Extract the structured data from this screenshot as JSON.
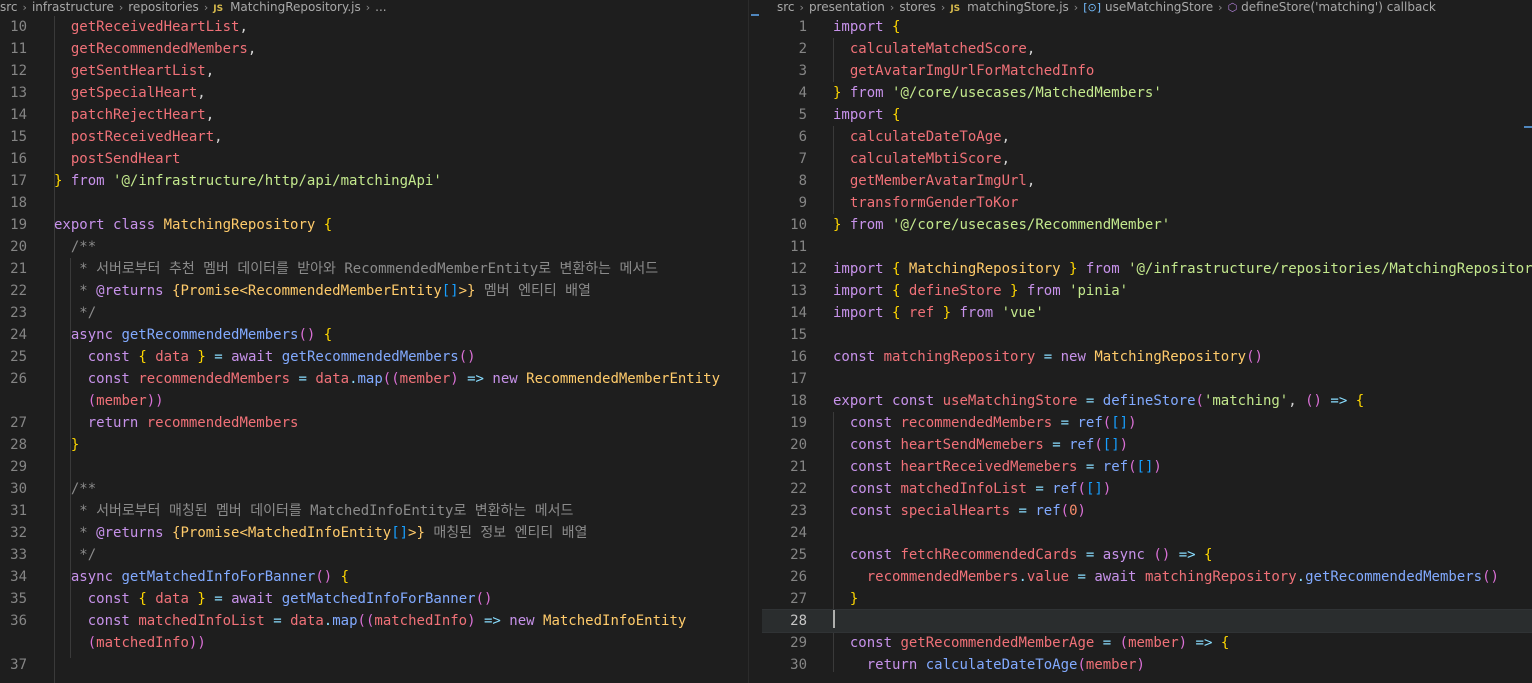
{
  "left_editor": {
    "breadcrumb": [
      "src",
      "infrastructure",
      "repositories",
      "MatchingRepository.js",
      "..."
    ],
    "file_icon": "JS",
    "lines": [
      {
        "n": "10",
        "src": "  getReceivedHeartList,"
      },
      {
        "n": "11",
        "src": "  getRecommendedMembers,"
      },
      {
        "n": "12",
        "src": "  getSentHeartList,"
      },
      {
        "n": "13",
        "src": "  getSpecialHeart,"
      },
      {
        "n": "14",
        "src": "  patchRejectHeart,"
      },
      {
        "n": "15",
        "src": "  postReceivedHeart,"
      },
      {
        "n": "16",
        "src": "  postSendHeart"
      },
      {
        "n": "17",
        "src": "} from '@/infrastructure/http/api/matchingApi'"
      },
      {
        "n": "18",
        "src": ""
      },
      {
        "n": "19",
        "src": "export class MatchingRepository {"
      },
      {
        "n": "20",
        "src": "  /**"
      },
      {
        "n": "21",
        "src": "   * 서버로부터 추천 멤버 데이터를 받아와 RecommendedMemberEntity로 변환하는 메서드"
      },
      {
        "n": "22",
        "src": "   * @returns {Promise<RecommendedMemberEntity[]>} 멤버 엔티티 배열"
      },
      {
        "n": "23",
        "src": "   */"
      },
      {
        "n": "24",
        "src": "  async getRecommendedMembers() {"
      },
      {
        "n": "25",
        "src": "    const { data } = await getRecommendedMembers()"
      },
      {
        "n": "26",
        "src": "    const recommendedMembers = data.map((member) => new RecommendedMemberEntity\n    (member))"
      },
      {
        "n": "27",
        "src": "    return recommendedMembers"
      },
      {
        "n": "28",
        "src": "  }"
      },
      {
        "n": "29",
        "src": ""
      },
      {
        "n": "30",
        "src": "  /**"
      },
      {
        "n": "31",
        "src": "   * 서버로부터 매칭된 멤버 데이터를 MatchedInfoEntity로 변환하는 메서드"
      },
      {
        "n": "32",
        "src": "   * @returns {Promise<MatchedInfoEntity[]>} 매칭된 정보 엔티티 배열"
      },
      {
        "n": "33",
        "src": "   */"
      },
      {
        "n": "34",
        "src": "  async getMatchedInfoForBanner() {"
      },
      {
        "n": "35",
        "src": "    const { data } = await getMatchedInfoForBanner()"
      },
      {
        "n": "36",
        "src": "    const matchedInfoList = data.map((matchedInfo) => new MatchedInfoEntity\n    (matchedInfo))"
      },
      {
        "n": "37",
        "src": ""
      }
    ]
  },
  "right_editor": {
    "breadcrumb": [
      "src",
      "presentation",
      "stores",
      "matchingStore.js",
      "useMatchingStore",
      "defineStore('matching') callback"
    ],
    "file_icon": "JS",
    "current_line": "28",
    "lines": [
      {
        "n": "1",
        "src": "import {"
      },
      {
        "n": "2",
        "src": "  calculateMatchedScore,"
      },
      {
        "n": "3",
        "src": "  getAvatarImgUrlForMatchedInfo"
      },
      {
        "n": "4",
        "src": "} from '@/core/usecases/MatchedMembers'"
      },
      {
        "n": "5",
        "src": "import {"
      },
      {
        "n": "6",
        "src": "  calculateDateToAge,"
      },
      {
        "n": "7",
        "src": "  calculateMbtiScore,"
      },
      {
        "n": "8",
        "src": "  getMemberAvatarImgUrl,"
      },
      {
        "n": "9",
        "src": "  transformGenderToKor"
      },
      {
        "n": "10",
        "src": "} from '@/core/usecases/RecommendMember'"
      },
      {
        "n": "11",
        "src": ""
      },
      {
        "n": "12",
        "src": "import { MatchingRepository } from '@/infrastructure/repositories/MatchingRepository'"
      },
      {
        "n": "13",
        "src": "import { defineStore } from 'pinia'"
      },
      {
        "n": "14",
        "src": "import { ref } from 'vue'"
      },
      {
        "n": "15",
        "src": ""
      },
      {
        "n": "16",
        "src": "const matchingRepository = new MatchingRepository()"
      },
      {
        "n": "17",
        "src": ""
      },
      {
        "n": "18",
        "src": "export const useMatchingStore = defineStore('matching', () => {"
      },
      {
        "n": "19",
        "src": "  const recommendedMembers = ref([])"
      },
      {
        "n": "20",
        "src": "  const heartSendMemebers = ref([])"
      },
      {
        "n": "21",
        "src": "  const heartReceivedMemebers = ref([])"
      },
      {
        "n": "22",
        "src": "  const matchedInfoList = ref([])"
      },
      {
        "n": "23",
        "src": "  const specialHearts = ref(0)"
      },
      {
        "n": "24",
        "src": ""
      },
      {
        "n": "25",
        "src": "  const fetchRecommendedCards = async () => {"
      },
      {
        "n": "26",
        "src": "    recommendedMembers.value = await matchingRepository.getRecommendedMembers()"
      },
      {
        "n": "27",
        "src": "  }"
      },
      {
        "n": "28",
        "src": ""
      },
      {
        "n": "29",
        "src": "  const getRecommendedMemberAge = (member) => {"
      },
      {
        "n": "30",
        "src": "    return calculateDateToAge(member)"
      }
    ]
  },
  "colors": {
    "background": "#1e1e1e",
    "line_number": "#858585",
    "current_line_bg": "#2a2d2e",
    "keyword": "#c792ea",
    "function": "#82aaff",
    "string": "#c3e88d",
    "class": "#ffcb6b",
    "variable": "#f07178",
    "comment": "#8b8b8b",
    "operator": "#89ddff"
  }
}
